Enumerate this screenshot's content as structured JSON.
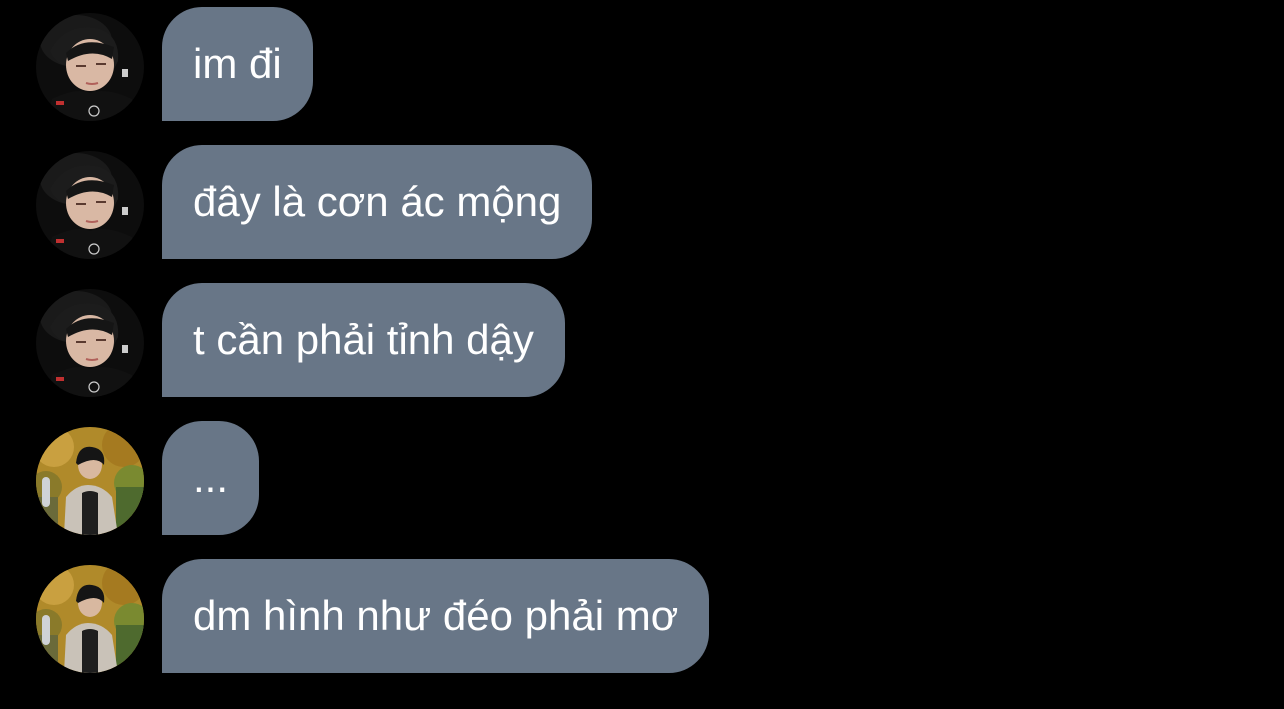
{
  "messages": [
    {
      "sender": "user_a",
      "text": "im đi"
    },
    {
      "sender": "user_a",
      "text": "đây là cơn ác mộng"
    },
    {
      "sender": "user_a",
      "text": "t cần phải tỉnh dậy"
    },
    {
      "sender": "user_b",
      "text": "..."
    },
    {
      "sender": "user_b",
      "text": "dm hình như đéo phải mơ"
    }
  ],
  "colors": {
    "background": "#000000",
    "bubble": "#687687",
    "bubble_text": "#ffffff"
  },
  "icons": {
    "user_a_avatar": "avatar-dark-portrait",
    "user_b_avatar": "avatar-outdoor-portrait"
  }
}
